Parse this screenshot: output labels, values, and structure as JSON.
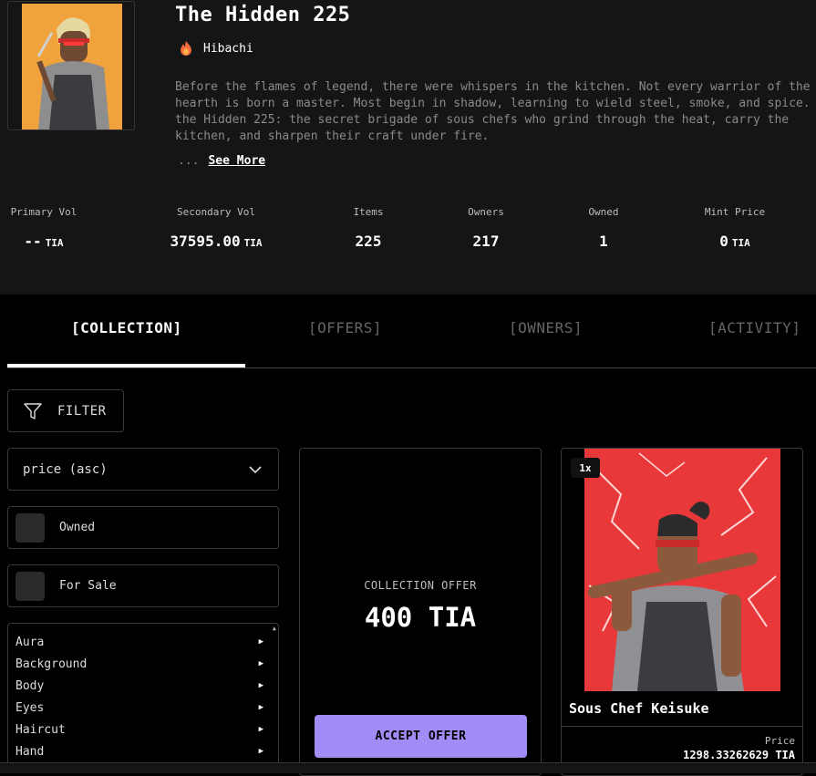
{
  "collection": {
    "title": "The Hidden 225",
    "creator": "Hibachi",
    "description_lines": [
      "Before the flames of legend, there were whispers in the kitchen. Not every warrior of the",
      "hearth is born a master. Most begin in shadow, learning to wield steel, smoke, and spice.",
      "the Hidden 225: the secret brigade of sous chefs who grind through the heat, carry the",
      "kitchen, and sharpen their craft under fire."
    ],
    "ellipsis": "...",
    "see_more": "See More"
  },
  "stats": [
    {
      "label": "Primary Vol",
      "value": "--",
      "unit": "TIA"
    },
    {
      "label": "Secondary Vol",
      "value": "37595.00",
      "unit": "TIA"
    },
    {
      "label": "Items",
      "value": "225",
      "unit": ""
    },
    {
      "label": "Owners",
      "value": "217",
      "unit": ""
    },
    {
      "label": "Owned",
      "value": "1",
      "unit": ""
    },
    {
      "label": "Mint Price",
      "value": "0",
      "unit": "TIA"
    }
  ],
  "tabs": [
    {
      "label": "[COLLECTION]",
      "active": true
    },
    {
      "label": "[OFFERS]",
      "active": false
    },
    {
      "label": "[OWNERS]",
      "active": false
    },
    {
      "label": "[ACTIVITY]",
      "active": false
    }
  ],
  "filters": {
    "filter_label": "FILTER",
    "sort_value": "price (asc)",
    "owned_label": "Owned",
    "for_sale_label": "For Sale",
    "traits": [
      "Aura",
      "Background",
      "Body",
      "Eyes",
      "Haircut",
      "Hand"
    ]
  },
  "offer_card": {
    "label": "COLLECTION OFFER",
    "amount": "400 TIA",
    "button": "ACCEPT OFFER"
  },
  "nft_card": {
    "quantity": "1x",
    "name": "Sous Chef Keisuke",
    "price_label": "Price",
    "price": "1298.33262629 TIA"
  },
  "colors": {
    "accent": "#a18cf6",
    "header_bg": "#151515",
    "avatar_bg": "#f0a23c",
    "nft_bg": "#e8383a"
  }
}
